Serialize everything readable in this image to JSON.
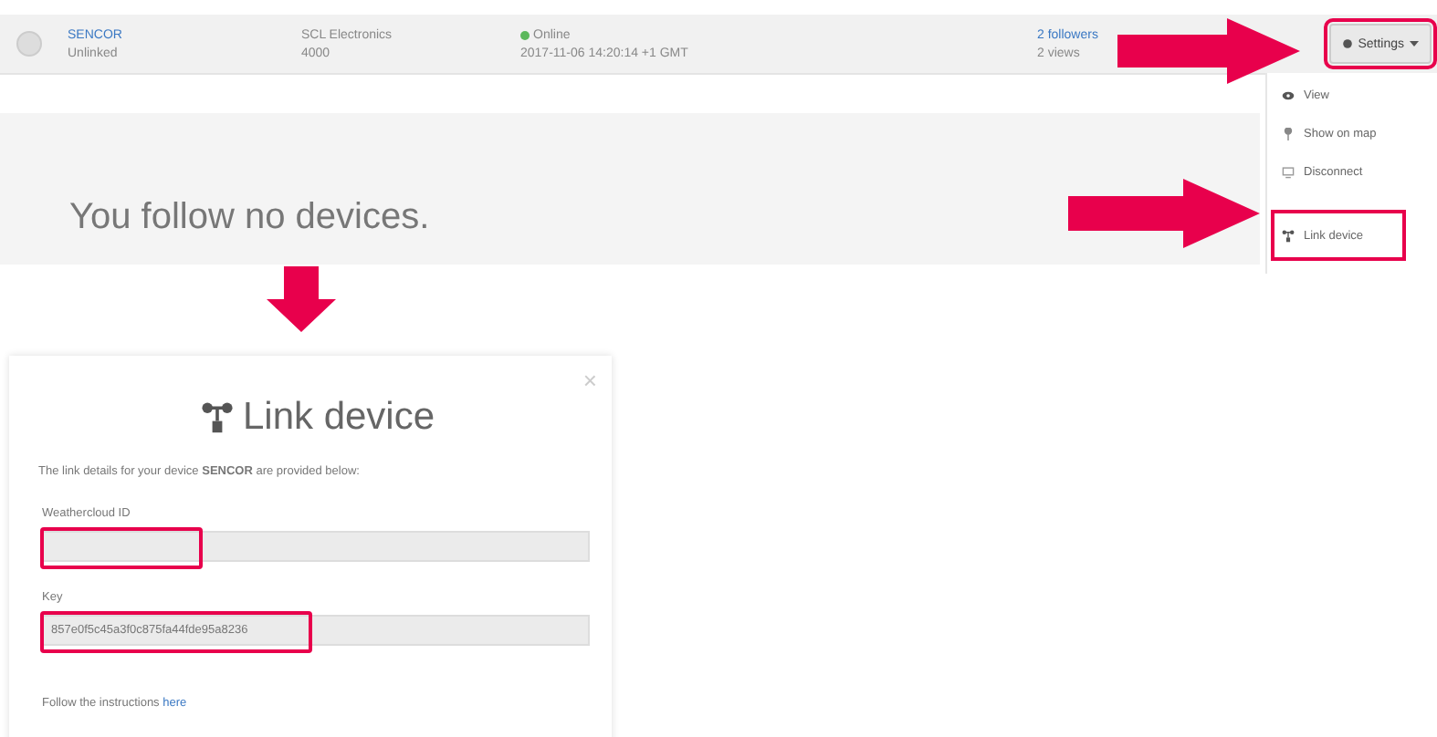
{
  "device_row": {
    "name": "SENCOR",
    "subtitle": "Unlinked",
    "brand": "SCL Electronics",
    "model": "4000",
    "status": "Online",
    "last_update": "2017-11-06 14:20:14 +1 GMT",
    "followers": "2 followers",
    "views": "2 views"
  },
  "settings_button": {
    "label": "Settings",
    "highlighted": true
  },
  "settings_menu": [
    {
      "label": "View",
      "kind": "eye",
      "highlighted": false
    },
    {
      "label": "Show on map",
      "kind": "pin",
      "highlighted": false
    },
    {
      "label": "Disconnect",
      "kind": "monitor",
      "highlighted": false
    },
    {
      "label": "Link device",
      "kind": "link",
      "highlighted": true
    }
  ],
  "empty_message": "You follow no devices.",
  "annotation_arrows": [
    {
      "kind": "right"
    },
    {
      "kind": "right"
    },
    {
      "kind": "down"
    }
  ],
  "dialog": {
    "title": "Link device",
    "close": "×",
    "intro": "The link details for your device **SENCOR** are provided below:",
    "fields": [
      {
        "label": "Weathercloud ID",
        "highlighted": true
      },
      {
        "label": "Key",
        "value": "857e0f5c45a3f0c875fa44fde95a8236",
        "highlighted": true
      }
    ],
    "footer": "Follow the instructions",
    "footer_link": "here"
  }
}
